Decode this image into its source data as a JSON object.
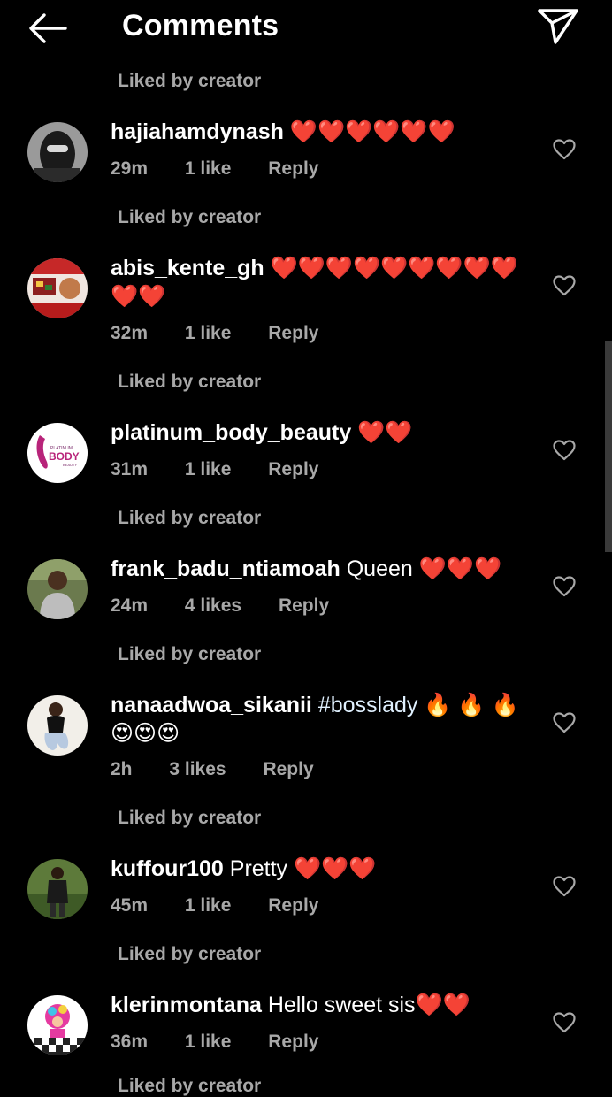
{
  "header": {
    "title": "Comments",
    "back_icon": "arrow-left-icon",
    "share_icon": "send-icon"
  },
  "liked_label": "Liked by creator",
  "comments": [
    {
      "username": "hajiahamdynash",
      "text": "❤️❤️❤️❤️❤️❤️",
      "time": "29m",
      "likes": "1 like",
      "reply": "Reply",
      "liked_by_creator": "Liked by creator"
    },
    {
      "username": "abis_kente_gh",
      "text": "❤️❤️❤️❤️❤️❤️❤️❤️❤️❤️❤️",
      "time": "32m",
      "likes": "1 like",
      "reply": "Reply",
      "liked_by_creator": "Liked by creator"
    },
    {
      "username": "platinum_body_beauty",
      "text": "❤️❤️",
      "time": "31m",
      "likes": "1 like",
      "reply": "Reply",
      "liked_by_creator": "Liked by creator",
      "avatar_text": "BODY",
      "avatar_text_top": "PLATINUM",
      "avatar_text_bottom": "BEAUTY"
    },
    {
      "username": "frank_badu_ntiamoah",
      "text": "Queen ❤️❤️❤️",
      "time": "24m",
      "likes": "4 likes",
      "reply": "Reply",
      "liked_by_creator": "Liked by creator"
    },
    {
      "username": "nanaadwoa_sikanii",
      "hashtag": "#bosslady",
      "text": "🔥 🔥 🔥 😍😍😍",
      "time": "2h",
      "likes": "3 likes",
      "reply": "Reply",
      "liked_by_creator": "Liked by creator"
    },
    {
      "username": "kuffour100",
      "text": "Pretty ❤️❤️❤️",
      "time": "45m",
      "likes": "1 like",
      "reply": "Reply",
      "liked_by_creator": "Liked by creator"
    },
    {
      "username": "klerinmontana",
      "text": "Hello sweet sis❤️❤️",
      "time": "36m",
      "likes": "1 like",
      "reply": "Reply",
      "liked_by_creator": "Liked by creator"
    }
  ],
  "colors": {
    "background": "#000000",
    "primary_text": "#ffffff",
    "secondary_text": "#a8a8a8",
    "hashtag": "#e0f1ff",
    "heart": "#ed1c24"
  }
}
